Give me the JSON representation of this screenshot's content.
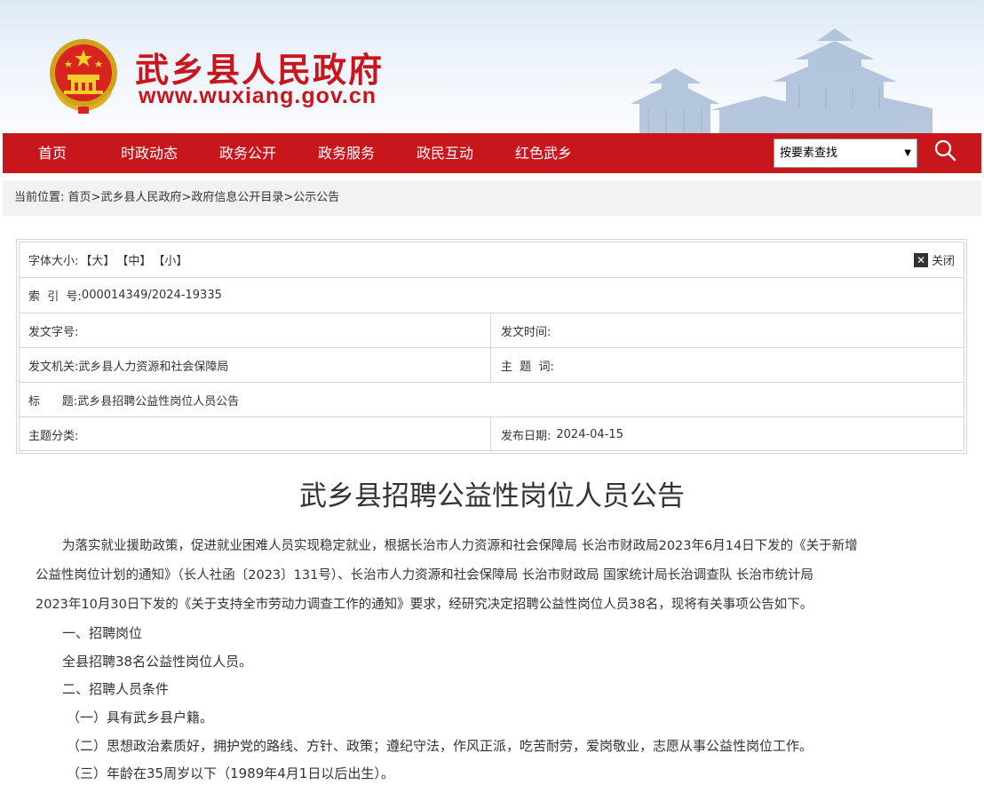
{
  "header": {
    "site_title": "武乡县人民政府",
    "site_url": "www.wuxiang.gov.cn",
    "brand_color": "#c8161d"
  },
  "nav": {
    "items": [
      "首页",
      "时政动态",
      "政务公开",
      "政务服务",
      "政民互动",
      "红色武乡"
    ],
    "search_select_value": "按要素查找",
    "search_icon": "search-icon"
  },
  "breadcrumb": {
    "label": "当前位置:",
    "items": [
      "首页",
      "武乡县人民政府",
      "政府信息公开目录",
      "公示公告"
    ],
    "sep": ">"
  },
  "meta": {
    "font_size_label": "字体大小:",
    "size_large": "【大】",
    "size_medium": "【中】",
    "size_small": "【小】",
    "close_label": "关闭",
    "index_label": "索  引  号:",
    "index_value": "000014349/2024-19335",
    "doc_no_label": "发文字号:",
    "doc_no_value": "",
    "doc_time_label": "发文时间:",
    "doc_time_value": "",
    "issuer_label": "发文机关:",
    "issuer_value": "武乡县人力资源和社会保障局",
    "keywords_label": "主  题  词:",
    "keywords_value": "",
    "title_label": "标      题:",
    "title_value": "武乡县招聘公益性岗位人员公告",
    "topic_label": "主题分类:",
    "topic_value": "",
    "publish_label": "发布日期:",
    "publish_value": "2024-04-15"
  },
  "article": {
    "title": "武乡县招聘公益性岗位人员公告",
    "intro_line1": "为落实就业援助政策，促进就业困难人员实现稳定就业，根据长治市人力资源和社会保障局  长治市财政局2023年6月14日下发的《关于新增",
    "intro_line2": "公益性岗位计划的通知》（长人社函〔2023〕131号）、长治市人力资源和社会保障局  长治市财政局  国家统计局长治调查队  长治市统计局",
    "intro_line3": "2023年10月30日下发的《关于支持全市劳动力调查工作的通知》要求，经研究决定招聘公益性岗位人员38名，现将有关事项公告如下。",
    "section1_heading": "一、招聘岗位",
    "section1_text": "全县招聘38名公益性岗位人员。",
    "section2_heading": "二、招聘人员条件",
    "cond1": "（一）具有武乡县户籍。",
    "cond2": "（二）思想政治素质好，拥护党的路线、方针、政策；遵纪守法，作风正派，吃苦耐劳，爱岗敬业，志愿从事公益性岗位工作。",
    "cond3": "（三）年龄在35周岁以下（1989年4月1日以后出生）。"
  }
}
